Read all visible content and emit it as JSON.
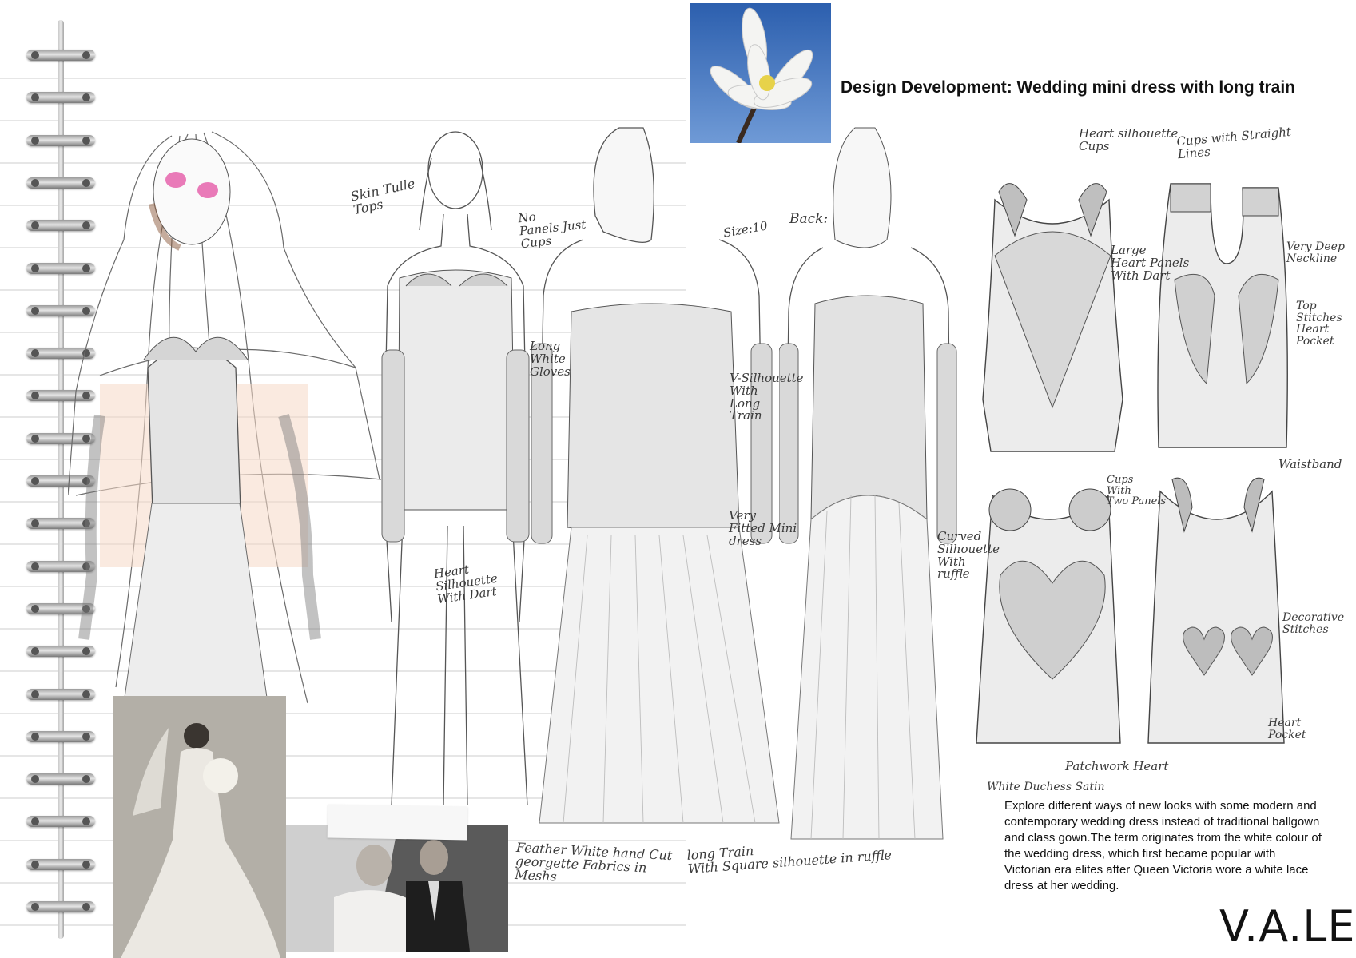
{
  "title": "Design Development: Wedding mini dress with long train",
  "description": "Explore different ways of new looks with some modern and contemporary wedding dress instead of traditional ballgown and class gown.The term originates from the white colour of the wedding dress, which first became popular with Victorian era elites after Queen Victoria wore a white lace dress at her wedding.",
  "logo": "V.A.LE",
  "annotations": {
    "skin_tulle": "Skin Tulle\nTops",
    "no_panels": "No\nPanels Just\nCups",
    "long_gloves": "Long\nWhite\nGloves",
    "heart_silhouette": "Heart\nSilhouette\nWith Dart",
    "size": "Size:10",
    "back": "Back:",
    "v_silhouette": "V-Silhouette\nWith\nLong\nTrain",
    "very_fitted": "Very\nFitted Mini\ndress",
    "feather": "Feather White hand Cut\ngeorgette Fabrics in\nMeshs",
    "long_train": "long Train\nWith Square silhouette in ruffle",
    "curved": "Curved\nSilhouette\nWith\nruffle",
    "heart_cups": "Heart silhouette\nCups",
    "cups_straight": "Cups with Straight\nLines",
    "large_heart": "Large\nHeart Panels\nWith Dart",
    "deep_neck": "Very Deep\nNeckline",
    "top_stitches": "Top Stitches\nHeart Pocket",
    "waistband": "Waistband",
    "cups_two": "Cups\nWith\nTwo Panels",
    "decorative": "Decorative\nStitches",
    "heart_pocket": "Heart\nPocket",
    "patchwork": "Patchwork Heart",
    "duchess": "White Duchess Satin"
  }
}
